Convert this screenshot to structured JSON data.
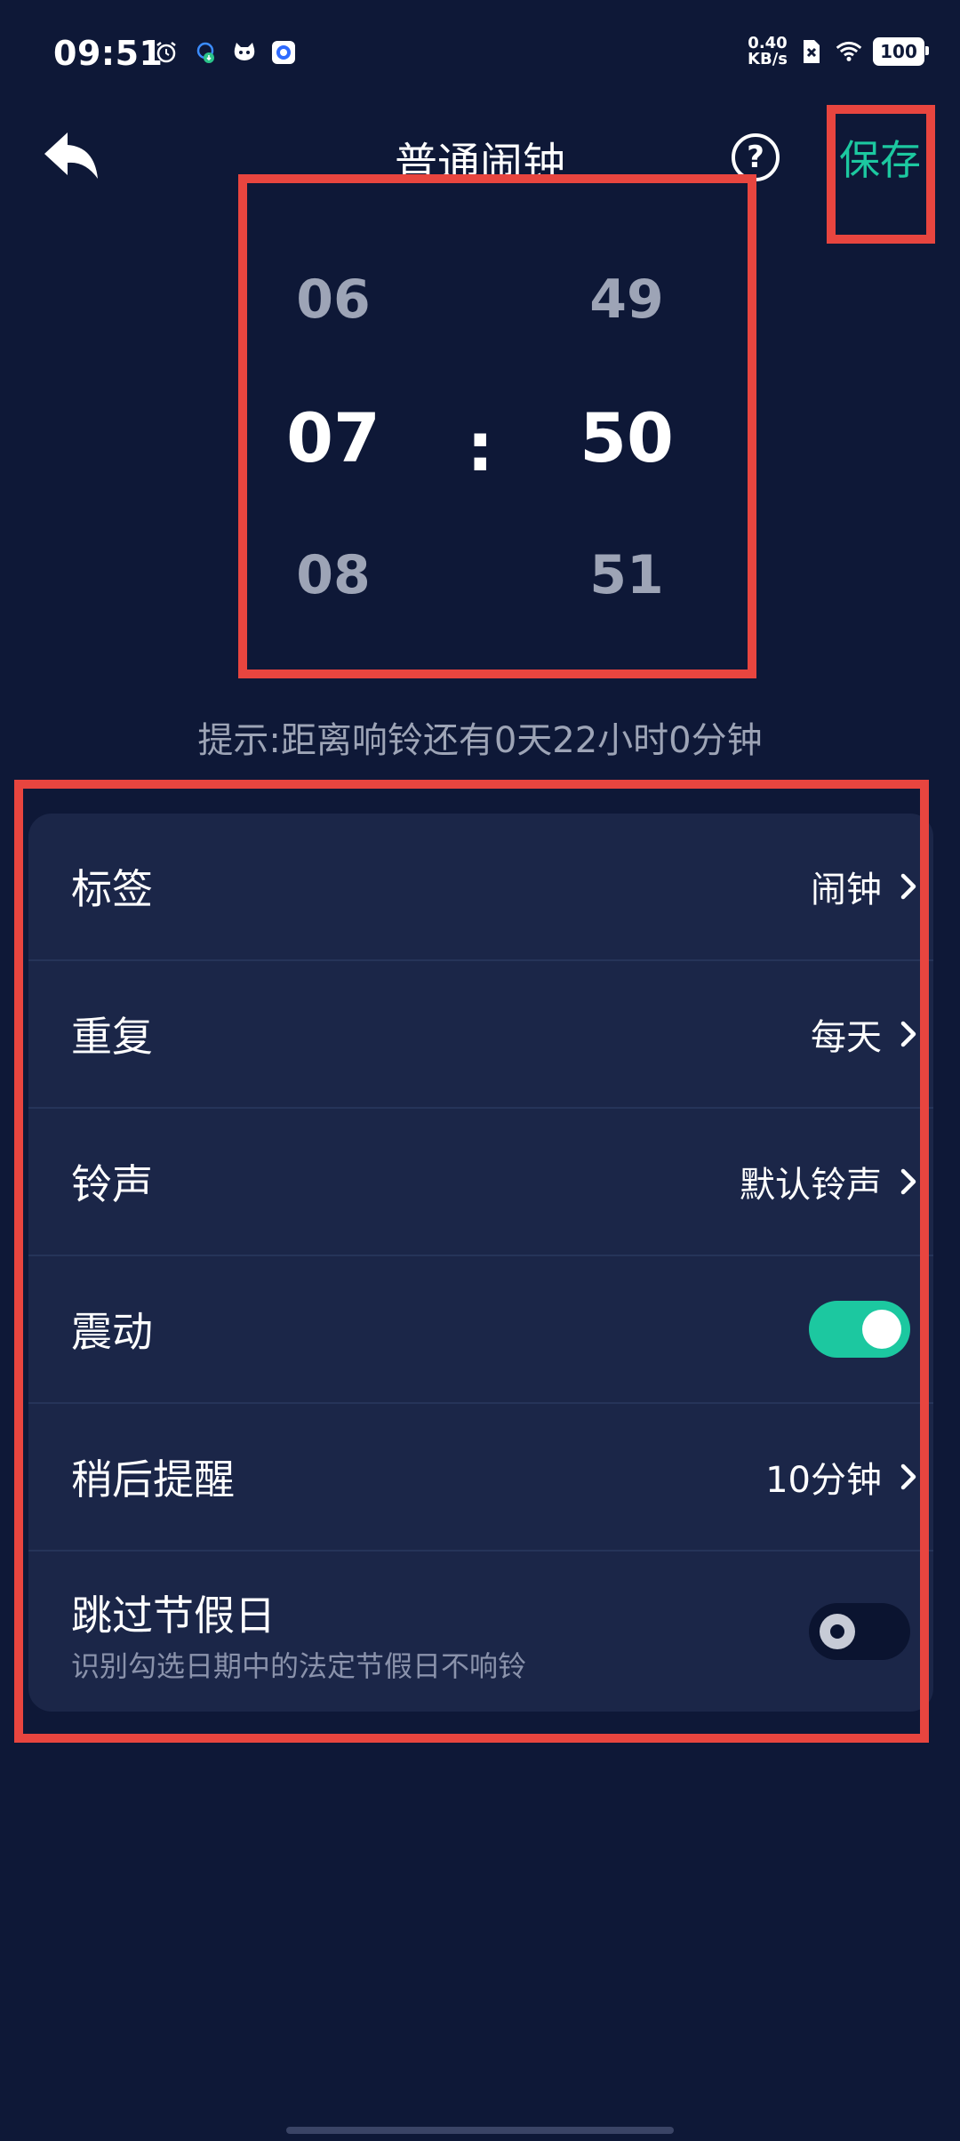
{
  "status_bar": {
    "time": "09:51",
    "net_speed_value": "0.40",
    "net_speed_unit": "KB/s",
    "battery": "100"
  },
  "header": {
    "title": "普通闹钟",
    "help_label": "?",
    "save_label": "保存"
  },
  "time_picker": {
    "hours": {
      "prev": "06",
      "current": "07",
      "next": "08"
    },
    "minutes": {
      "prev": "49",
      "current": "50",
      "next": "51"
    },
    "separator": ":"
  },
  "hint": "提示:距离响铃还有0天22小时0分钟",
  "settings": {
    "label_row": {
      "label": "标签",
      "value": "闹钟"
    },
    "repeat_row": {
      "label": "重复",
      "value": "每天"
    },
    "ringtone_row": {
      "label": "铃声",
      "value": "默认铃声"
    },
    "vibrate_row": {
      "label": "震动",
      "enabled": true
    },
    "snooze_row": {
      "label": "稍后提醒",
      "value": "10分钟"
    },
    "holiday_row": {
      "label": "跳过节假日",
      "sublabel": "识别勾选日期中的法定节假日不响铃",
      "enabled": false
    }
  },
  "colors": {
    "background": "#0E1837",
    "card": "#1B2648",
    "accent": "#1CC8A0",
    "annotation": "#E8453F"
  }
}
